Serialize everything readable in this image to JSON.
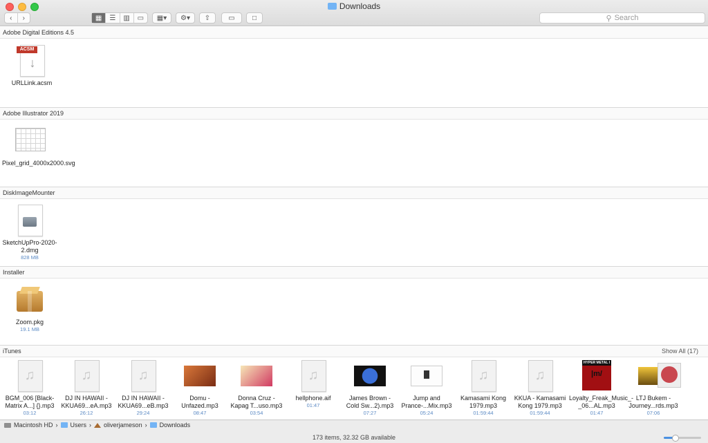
{
  "window": {
    "title": "Downloads"
  },
  "toolbar": {
    "back_icon": "chevron-left-icon",
    "forward_icon": "chevron-right-icon",
    "view_modes": [
      "icon-view",
      "list-view",
      "column-view",
      "gallery-view"
    ],
    "search_placeholder": "Search"
  },
  "sections": [
    {
      "title": "Adobe Digital Editions 4.5",
      "files": [
        {
          "name": "URLLink.acsm",
          "meta": "",
          "badge": "ACSM"
        }
      ]
    },
    {
      "title": "Adobe Illustrator 2019",
      "files": [
        {
          "name": "Pixel_grid_4000x2000.svg",
          "meta": ""
        }
      ]
    },
    {
      "title": "DiskImageMounter",
      "files": [
        {
          "name": "SketchUpPro-2020-2.dmg",
          "meta": "828 MB"
        }
      ]
    },
    {
      "title": "Installer",
      "files": [
        {
          "name": "Zoom.pkg",
          "meta": "19.1 MB"
        }
      ]
    },
    {
      "title": "iTunes",
      "show_all": "Show All (17)",
      "files": [
        {
          "name": "BGM_006 [Black-Matrix A...] {}.mp3",
          "meta": "03:12"
        },
        {
          "name": "DJ IN HAWAII - KKUA69...eA.mp3",
          "meta": "26:12"
        },
        {
          "name": "DJ IN HAWAII - KKUA69...eB.mp3",
          "meta": "29:24"
        },
        {
          "name": "Domu - Unfazed.mp3",
          "meta": "08:47"
        },
        {
          "name": "Donna Cruz - Kapag T...uso.mp3",
          "meta": "03:54"
        },
        {
          "name": "hellphone.aif",
          "meta": "01:47"
        },
        {
          "name": "James Brown - Cold Sw...2).mp3",
          "meta": "07:27"
        },
        {
          "name": "Jump and Prance-...Mix.mp3",
          "meta": "05:24"
        },
        {
          "name": "Kamasami Kong 1979.mp3",
          "meta": "01:59:44"
        },
        {
          "name": "KKUA - Kamasami Kong 1979.mp3",
          "meta": "01:59:44"
        },
        {
          "name": "Loyalty_Freak_Music_-_06...AL.mp3",
          "meta": "01:47"
        },
        {
          "name": "LTJ Bukem - Journey...rds.mp3",
          "meta": "07:06"
        }
      ]
    }
  ],
  "path_bar": [
    "Macintosh HD",
    "Users",
    "oliverjameson",
    "Downloads"
  ],
  "status_text": "173 items, 32.32 GB available",
  "icon_size_level": 0.3,
  "album_art_texts": {
    "hyper_metal": "HYPER METAL I",
    "m_mark": "|m/"
  }
}
